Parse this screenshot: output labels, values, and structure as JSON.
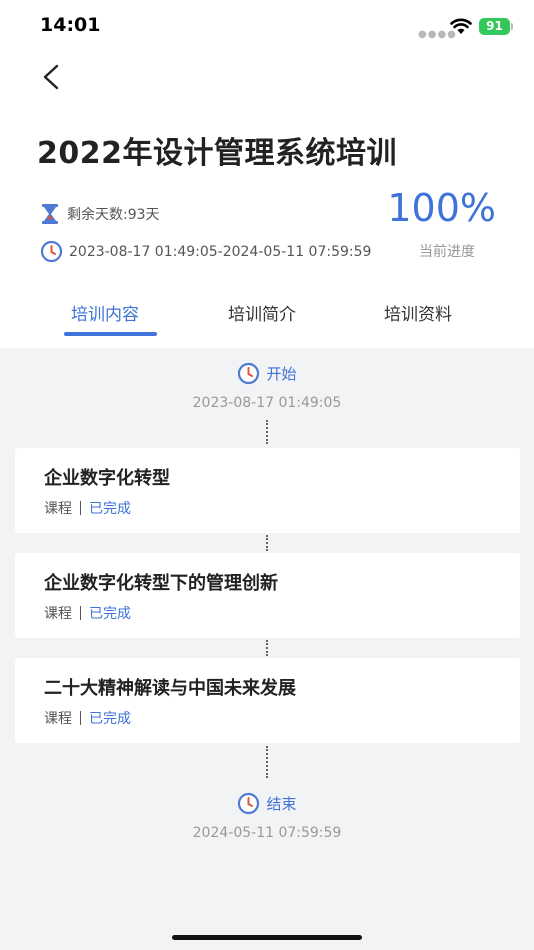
{
  "status_bar": {
    "time": "14:01",
    "battery": "91"
  },
  "header": {
    "title": "2022年设计管理系统培训",
    "days_left": "剩余天数:93天",
    "date_range": "2023-08-17 01:49:05-2024-05-11 07:59:59",
    "progress_value": "100%",
    "progress_label": "当前进度"
  },
  "tabs": [
    {
      "label": "培训内容",
      "active": true
    },
    {
      "label": "培训简介",
      "active": false
    },
    {
      "label": "培训资料",
      "active": false
    }
  ],
  "timeline": {
    "start": {
      "label": "开始",
      "time": "2023-08-17 01:49:05"
    },
    "end": {
      "label": "结束",
      "time": "2024-05-11 07:59:59"
    },
    "items": [
      {
        "title": "企业数字化转型",
        "type": "课程",
        "status": "已完成"
      },
      {
        "title": "企业数字化转型下的管理创新",
        "type": "课程",
        "status": "已完成"
      },
      {
        "title": "二十大精神解读与中国未来发展",
        "type": "课程",
        "status": "已完成"
      }
    ]
  },
  "colors": {
    "accent": "#3f73d9",
    "battery": "#34c759",
    "hourglass": "#4f79d3",
    "clock_hand": "#e0563a"
  }
}
